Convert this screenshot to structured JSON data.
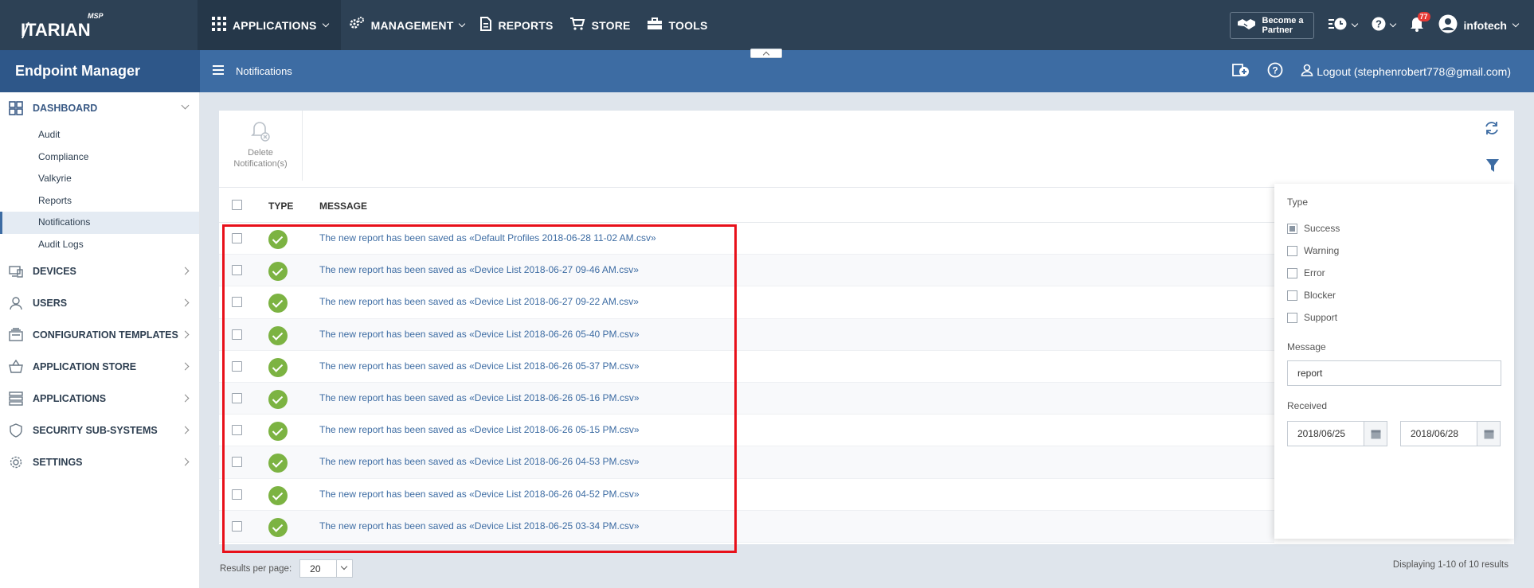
{
  "topbar": {
    "logo_text": "ITARIAN",
    "logo_badge": "MSP",
    "nav": [
      {
        "label": "APPLICATIONS",
        "icon": "grid-icon"
      },
      {
        "label": "MANAGEMENT",
        "icon": "gears-icon"
      },
      {
        "label": "REPORTS",
        "icon": "report-icon"
      },
      {
        "label": "STORE",
        "icon": "cart-icon"
      },
      {
        "label": "TOOLS",
        "icon": "toolbox-icon"
      }
    ],
    "partner_label": "Become a Partner",
    "notification_count": "77",
    "user_name": "infotech"
  },
  "bar2": {
    "app_title": "Endpoint Manager",
    "breadcrumb": "Notifications",
    "logout_label": "Logout (stephenrobert778@gmail.com)"
  },
  "sidebar": {
    "dashboard": {
      "label": "DASHBOARD",
      "items": [
        "Audit",
        "Compliance",
        "Valkyrie",
        "Reports",
        "Notifications",
        "Audit Logs"
      ]
    },
    "groups": [
      {
        "label": "DEVICES",
        "icon": "devices-icon"
      },
      {
        "label": "USERS",
        "icon": "user-icon"
      },
      {
        "label": "CONFIGURATION TEMPLATES",
        "icon": "templates-icon"
      },
      {
        "label": "APPLICATION STORE",
        "icon": "basket-icon"
      },
      {
        "label": "APPLICATIONS",
        "icon": "applications-icon"
      },
      {
        "label": "SECURITY SUB-SYSTEMS",
        "icon": "shield-icon"
      },
      {
        "label": "SETTINGS",
        "icon": "gear-icon"
      }
    ]
  },
  "toolbar": {
    "delete_label": "Delete Notification(s)"
  },
  "table": {
    "headers": {
      "type": "TYPE",
      "message": "MESSAGE"
    },
    "rows": [
      "The new report has been saved as «Default Profiles 2018-06-28 11-02 AM.csv»",
      "The new report has been saved as «Device List 2018-06-27 09-46 AM.csv»",
      "The new report has been saved as «Device List 2018-06-27 09-22 AM.csv»",
      "The new report has been saved as «Device List 2018-06-26 05-40 PM.csv»",
      "The new report has been saved as «Device List 2018-06-26 05-37 PM.csv»",
      "The new report has been saved as «Device List 2018-06-26 05-16 PM.csv»",
      "The new report has been saved as «Device List 2018-06-26 05-15 PM.csv»",
      "The new report has been saved as «Device List 2018-06-26 04-53 PM.csv»",
      "The new report has been saved as «Device List 2018-06-26 04-52 PM.csv»",
      "The new report has been saved as «Device List 2018-06-25 03-34 PM.csv»"
    ]
  },
  "filter": {
    "type_label": "Type",
    "types": [
      {
        "label": "Success",
        "checked": true
      },
      {
        "label": "Warning",
        "checked": false
      },
      {
        "label": "Error",
        "checked": false
      },
      {
        "label": "Blocker",
        "checked": false
      },
      {
        "label": "Support",
        "checked": false
      }
    ],
    "message_label": "Message",
    "message_value": "report",
    "received_label": "Received",
    "date_from": "2018/06/25",
    "date_to": "2018/06/28"
  },
  "footer": {
    "per_page_label": "Results per page:",
    "per_page_value": "20",
    "summary": "Displaying 1-10 of 10 results"
  }
}
